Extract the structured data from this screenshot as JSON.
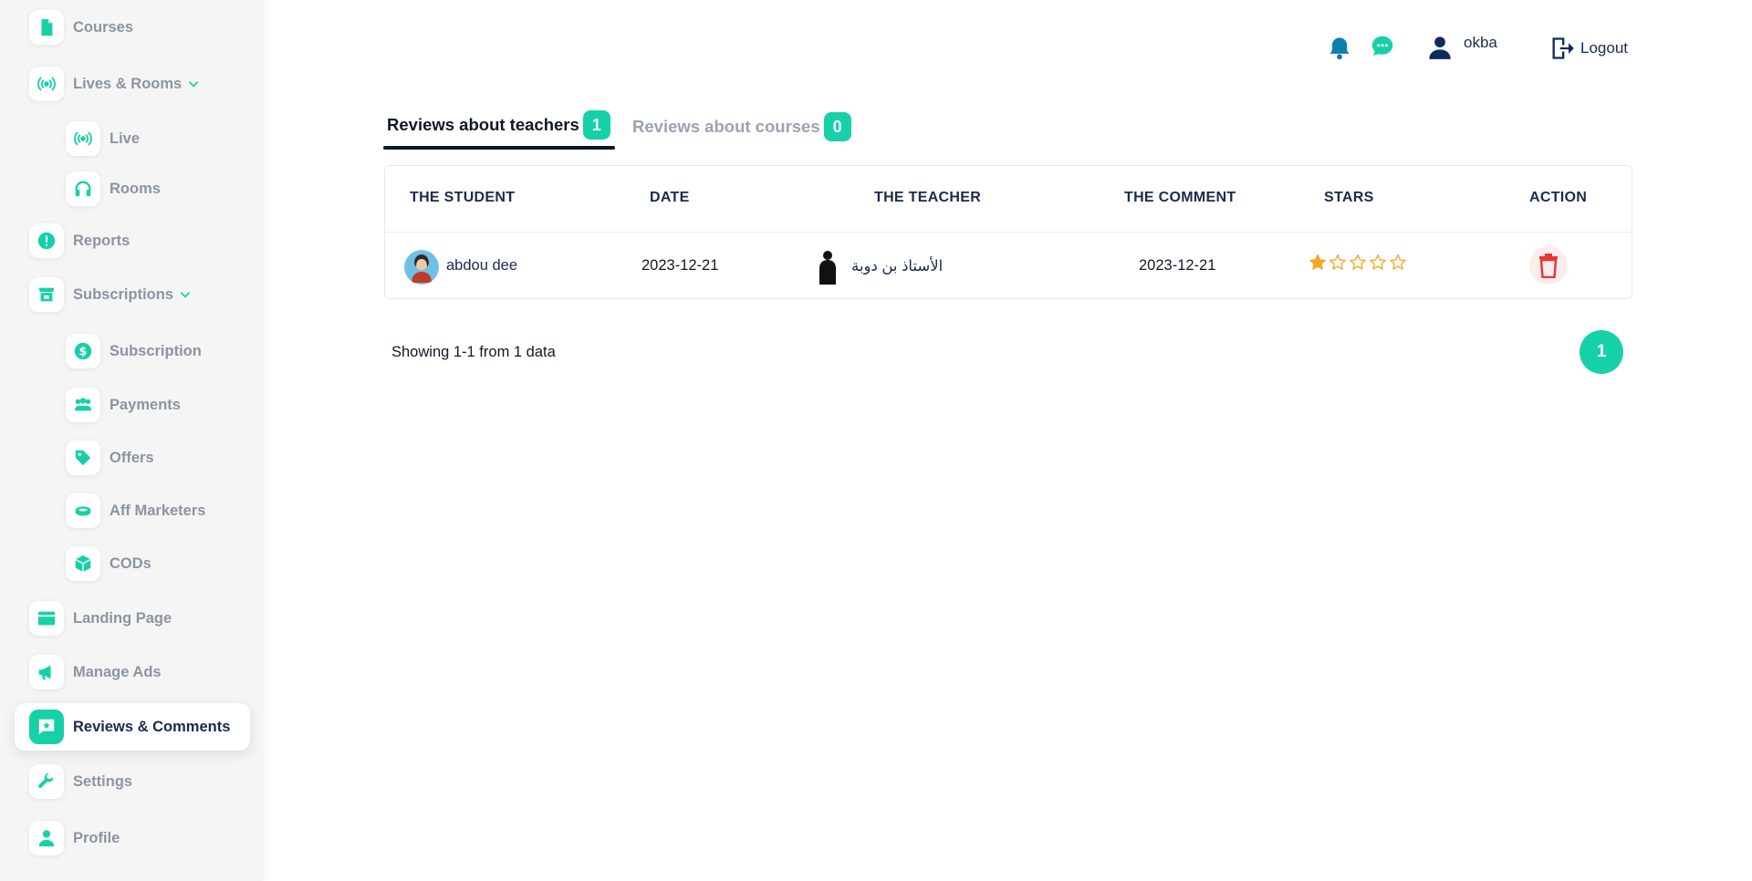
{
  "sidebar": {
    "items": [
      {
        "label": "Courses",
        "icon": "file-icon"
      },
      {
        "label": "Lives & Rooms",
        "icon": "broadcast-icon"
      },
      {
        "label": "Live",
        "icon": "broadcast-icon"
      },
      {
        "label": "Rooms",
        "icon": "headphones-icon"
      },
      {
        "label": "Reports",
        "icon": "alert-icon"
      },
      {
        "label": "Subscriptions",
        "icon": "store-icon"
      },
      {
        "label": "Subscription",
        "icon": "dollar-icon"
      },
      {
        "label": "Payments",
        "icon": "users-icon"
      },
      {
        "label": "Offers",
        "icon": "tag-icon"
      },
      {
        "label": "Aff Marketers",
        "icon": "ring-icon"
      },
      {
        "label": "CODs",
        "icon": "box-icon"
      },
      {
        "label": "Landing Page",
        "icon": "window-icon"
      },
      {
        "label": "Manage Ads",
        "icon": "megaphone-icon"
      },
      {
        "label": "Reviews & Comments",
        "icon": "star-message-icon"
      },
      {
        "label": "Settings",
        "icon": "wrench-icon"
      },
      {
        "label": "Profile",
        "icon": "user-icon"
      }
    ],
    "active": "Reviews & Comments"
  },
  "header": {
    "user_name": "okba",
    "logout_label": "Logout"
  },
  "tabs": [
    {
      "label": "Reviews about teachers",
      "count": "1",
      "active": true
    },
    {
      "label": "Reviews about courses",
      "count": "0",
      "active": false
    }
  ],
  "table": {
    "columns": [
      "THE STUDENT",
      "DATE",
      "THE TEACHER",
      "THE COMMENT",
      "STARS",
      "ACTION"
    ],
    "rows": [
      {
        "student": "abdou dee",
        "date": "2023-12-21",
        "teacher": "الأستاذ بن دوبة",
        "comment": "2023-12-21",
        "stars": 1,
        "max_stars": 5
      }
    ]
  },
  "footer": {
    "showing_text": "Showing 1-1 from 1 data",
    "current_page": "1"
  },
  "colors": {
    "accent": "#16d1a8",
    "navy": "#1a2b4c",
    "star": "#f5a623",
    "delete": "#e53935"
  }
}
